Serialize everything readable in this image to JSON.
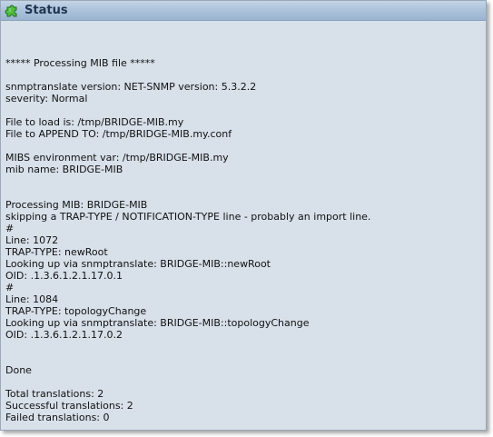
{
  "window": {
    "title": "Status",
    "icon": "puzzle-piece-icon",
    "accent": "#3aa33a"
  },
  "log": {
    "lines": [
      "***** Processing MIB file *****",
      "",
      "snmptranslate version: NET-SNMP version: 5.3.2.2",
      "severity: Normal",
      "",
      "File to load is: /tmp/BRIDGE-MIB.my",
      "File to APPEND TO: /tmp/BRIDGE-MIB.my.conf",
      "",
      "MIBS environment var: /tmp/BRIDGE-MIB.my",
      "mib name: BRIDGE-MIB",
      "",
      "",
      "Processing MIB: BRIDGE-MIB",
      "skipping a TRAP-TYPE / NOTIFICATION-TYPE line - probably an import line.",
      "#",
      "Line: 1072",
      "TRAP-TYPE: newRoot",
      "Looking up via snmptranslate: BRIDGE-MIB::newRoot",
      "OID: .1.3.6.1.2.1.17.0.1",
      "#",
      "Line: 1084",
      "TRAP-TYPE: topologyChange",
      "Looking up via snmptranslate: BRIDGE-MIB::topologyChange",
      "OID: .1.3.6.1.2.1.17.0.2",
      "",
      "",
      "Done",
      "",
      "Total translations: 2",
      "Successful translations: 2",
      "Failed translations: 0"
    ]
  }
}
